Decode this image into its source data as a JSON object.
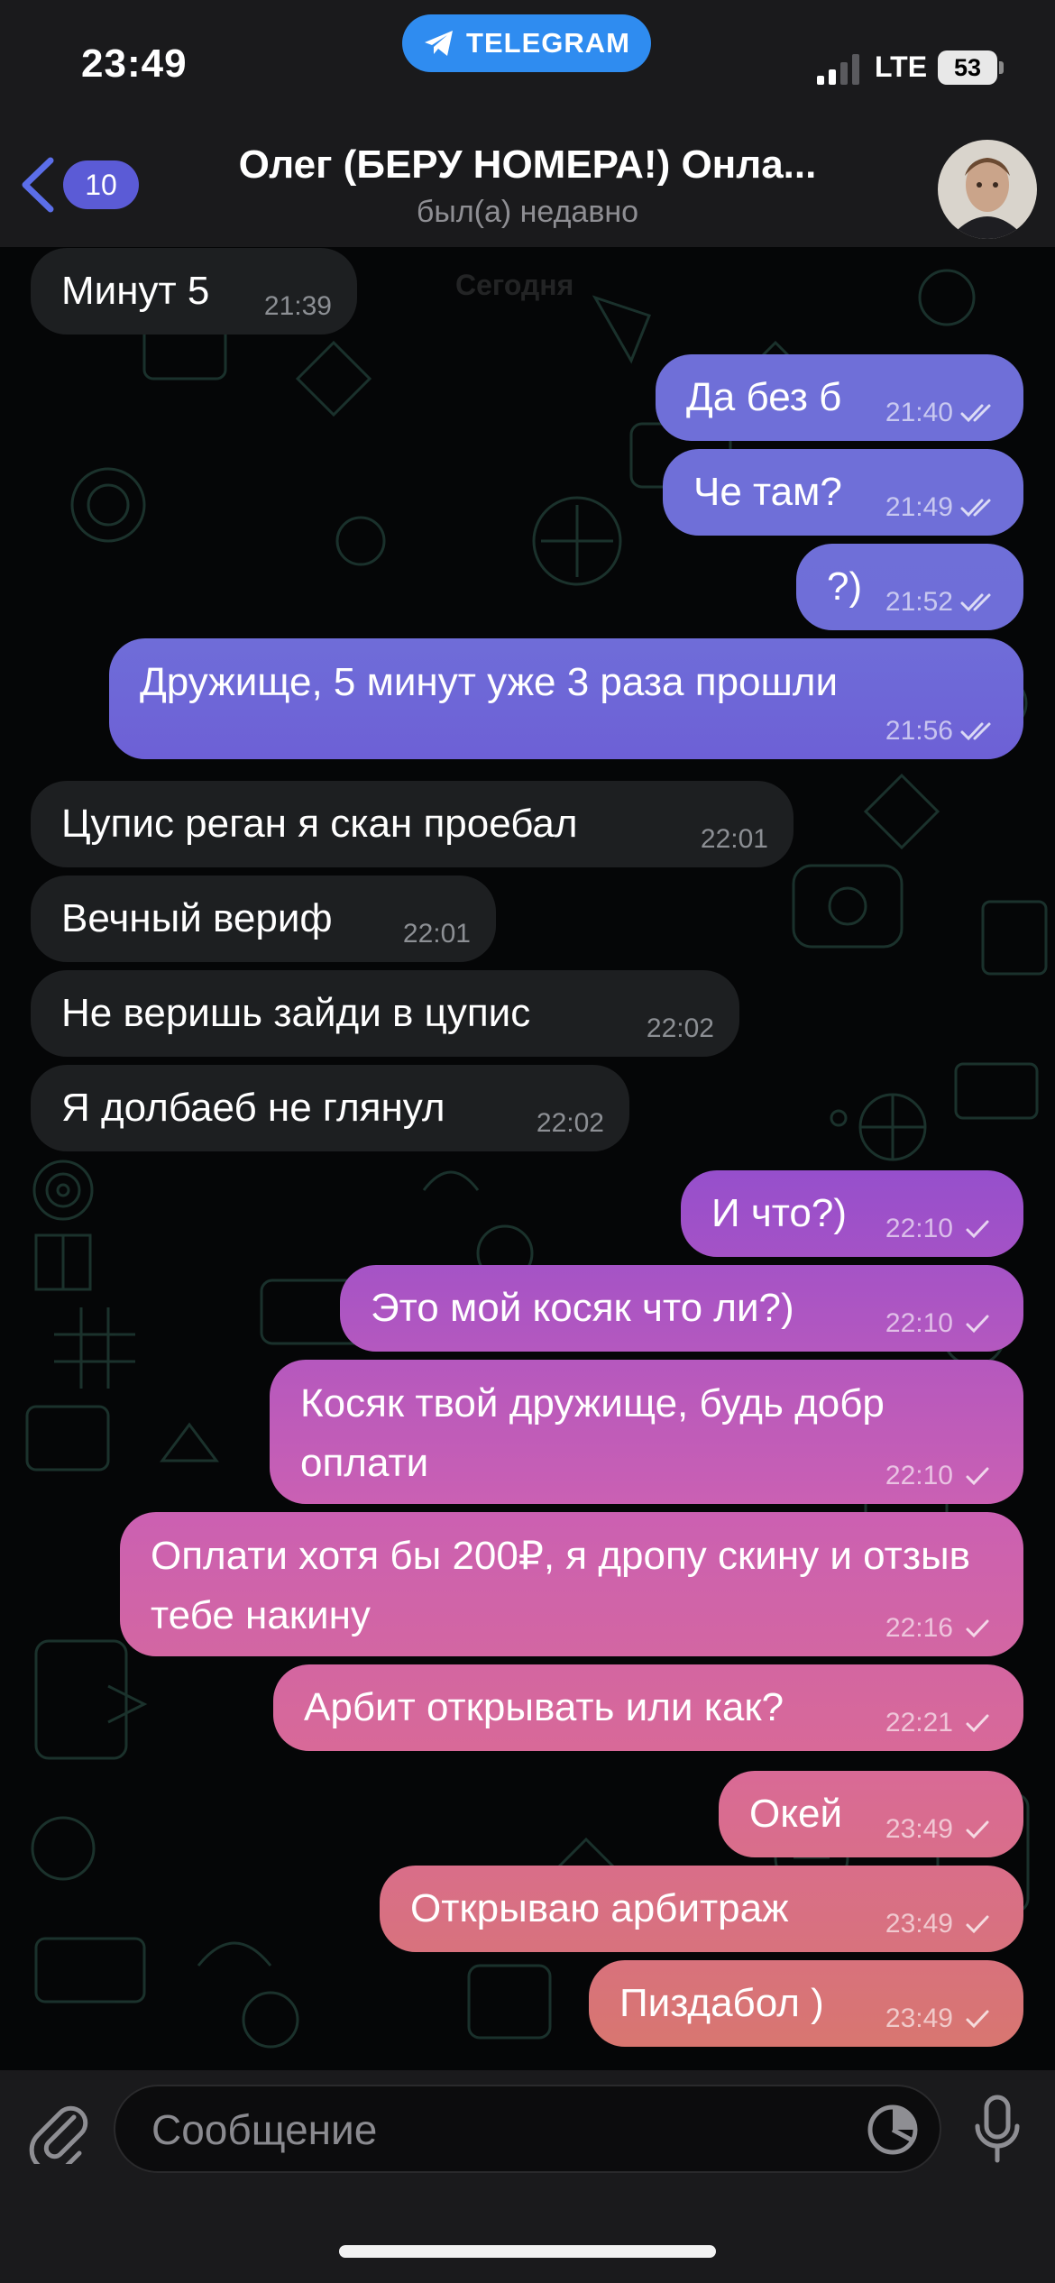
{
  "status_bar": {
    "time": "23:49",
    "app_pill": "TELEGRAM",
    "network": "LTE",
    "battery": "53"
  },
  "header": {
    "back_badge": "10",
    "title": "Олег (БЕРУ НОМЕРА!) Онла...",
    "subtitle": "был(а) недавно",
    "date_label": "Сегодня"
  },
  "messages": [
    {
      "dir": "in",
      "text": "Минут 5",
      "time": "21:39"
    },
    {
      "dir": "out",
      "text": "Да без б",
      "time": "21:40",
      "status": "read"
    },
    {
      "dir": "out",
      "text": "Че там?",
      "time": "21:49",
      "status": "read"
    },
    {
      "dir": "out",
      "text": "?)",
      "time": "21:52",
      "status": "read"
    },
    {
      "dir": "out",
      "text": "Дружище, 5 минут уже 3 раза прошли",
      "time": "21:56",
      "status": "read"
    },
    {
      "dir": "in",
      "text": "Цупис реган я скан проебал",
      "time": "22:01"
    },
    {
      "dir": "in",
      "text": "Вечный вериф",
      "time": "22:01"
    },
    {
      "dir": "in",
      "text": "Не веришь зайди в цупис",
      "time": "22:02"
    },
    {
      "dir": "in",
      "text": "Я долбаеб не глянул",
      "time": "22:02"
    },
    {
      "dir": "out",
      "text": "И что?)",
      "time": "22:10",
      "status": "sent"
    },
    {
      "dir": "out",
      "text": "Это мой косяк что ли?)",
      "time": "22:10",
      "status": "sent"
    },
    {
      "dir": "out",
      "text": "Косяк твой дружище, будь добр оплати",
      "time": "22:10",
      "status": "sent"
    },
    {
      "dir": "out",
      "text": "Оплати хотя бы 200₽, я дропу скину и отзыв тебе накину",
      "time": "22:16",
      "status": "sent"
    },
    {
      "dir": "out",
      "text": "Арбит открывать или как?",
      "time": "22:21",
      "status": "sent"
    },
    {
      "dir": "out",
      "text": "Окей",
      "time": "23:49",
      "status": "sent"
    },
    {
      "dir": "out",
      "text": "Открываю арбитраж",
      "time": "23:49",
      "status": "sent"
    },
    {
      "dir": "out",
      "text": "Пиздабол )",
      "time": "23:49",
      "status": "sent"
    }
  ],
  "input": {
    "placeholder": "Сообщение"
  },
  "colors": {
    "incoming_bubble": "#1d1f21",
    "accent": "#2f8cf0",
    "badge": "#5b5bd6",
    "outgoing_gradient": [
      "#6f6fd8",
      "#6a50d4",
      "#9a4fcb",
      "#c95fb5",
      "#d96a96",
      "#d8766f"
    ]
  }
}
